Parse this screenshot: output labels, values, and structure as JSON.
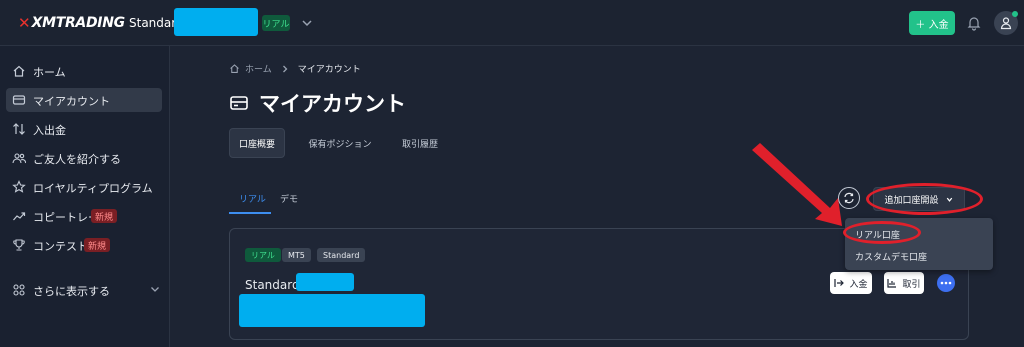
{
  "header": {
    "logo_mark": "✕",
    "logo_text": "XMTRADING",
    "account_name": "Standard",
    "account_type_tag": "リアル",
    "deposit_button": "＋ 入金",
    "icons": [
      "chevron-down-icon",
      "bell-icon",
      "user-icon"
    ],
    "colors": {
      "accent_green": "#22c28a",
      "brand_red": "#e8322d"
    }
  },
  "sidebar": {
    "items": [
      {
        "label": "ホーム",
        "icon": "home-icon"
      },
      {
        "label": "マイアカウント",
        "icon": "card-icon",
        "active": true
      },
      {
        "label": "入出金",
        "icon": "transfer-icon"
      },
      {
        "label": "ご友人を紹介する",
        "icon": "users-icon"
      },
      {
        "label": "ロイヤルティプログラム",
        "icon": "star-icon"
      },
      {
        "label": "コピートレード",
        "icon": "trend-icon",
        "badge": "新規"
      },
      {
        "label": "コンテスト",
        "icon": "trophy-icon",
        "badge": "新規"
      },
      {
        "label": "さらに表示する",
        "icon": "grid-icon"
      }
    ]
  },
  "main": {
    "breadcrumb": {
      "home": "ホーム",
      "current": "マイアカウント"
    },
    "title": "マイアカウント",
    "tabs": [
      {
        "label": "口座概要",
        "active": true
      },
      {
        "label": "保有ポジション"
      },
      {
        "label": "取引履歴"
      }
    ],
    "subtabs": [
      {
        "label": "リアル",
        "active": true
      },
      {
        "label": "デモ"
      }
    ],
    "add_account_button": "追加口座開設",
    "dropdown": {
      "items": [
        "リアル口座",
        "カスタムデモ口座"
      ]
    },
    "account_card": {
      "chips": [
        "リアル",
        "MT5",
        "Standard"
      ],
      "name": "Standard",
      "deposit_button": "入金",
      "withdraw_button": "取引"
    },
    "colors": {
      "link_blue": "#3d8ef0",
      "annotation_red": "#e0202b",
      "redaction": "#00aeef"
    }
  }
}
